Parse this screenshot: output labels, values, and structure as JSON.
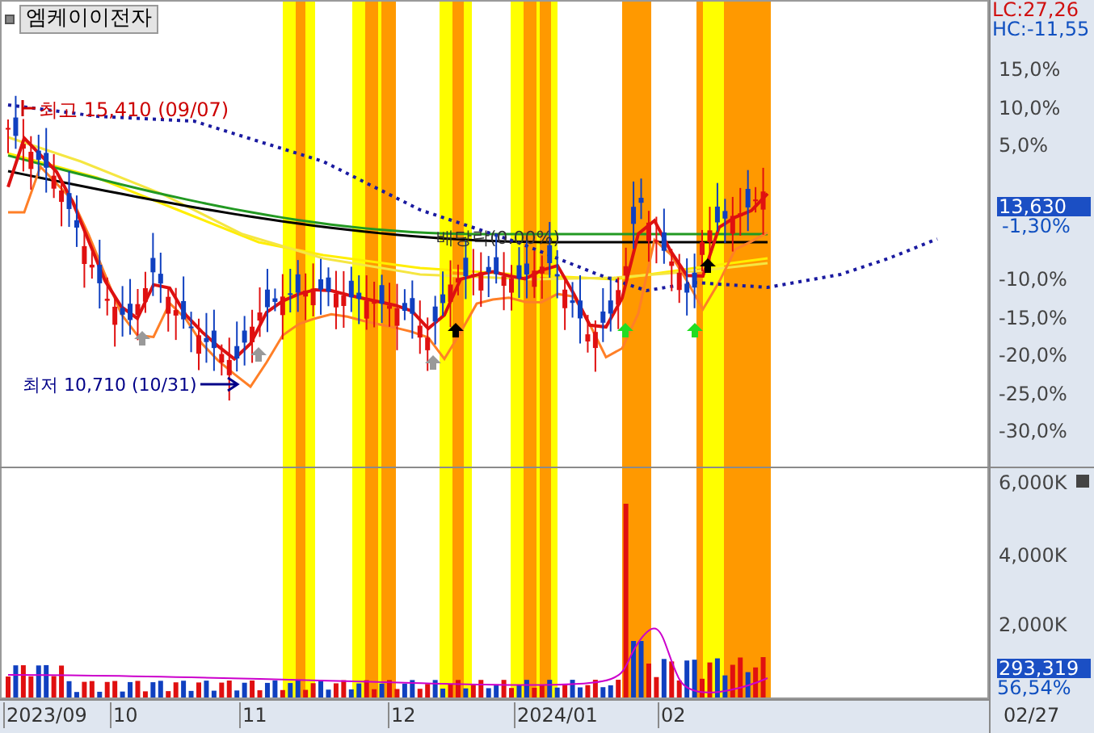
{
  "title": "엠케이이전자",
  "price_chart": {
    "high_label": "최고 15,410 (09/07)",
    "low_label": "최저 10,710 (10/31)",
    "event_label": "배당락(0.00%)",
    "axis_header": [
      "LC:27,26",
      "HC:-11,55"
    ],
    "ticks": [
      "15,0%",
      "10,0%",
      "5,0%",
      "-10,0%",
      "-15,0%",
      "-20,0%",
      "-25,0%",
      "-30,0%"
    ],
    "price_badge": "13,630",
    "change": "-1,30%"
  },
  "volume_chart": {
    "ticks": [
      "6,000K",
      "4,000K",
      "2,000K"
    ],
    "volume_badge": "293,319",
    "ratio": "56,54%"
  },
  "x_axis": {
    "labels": [
      "2023/09",
      "10",
      "11",
      "12",
      "2024/01",
      "02"
    ],
    "last_date": "02/27"
  }
}
